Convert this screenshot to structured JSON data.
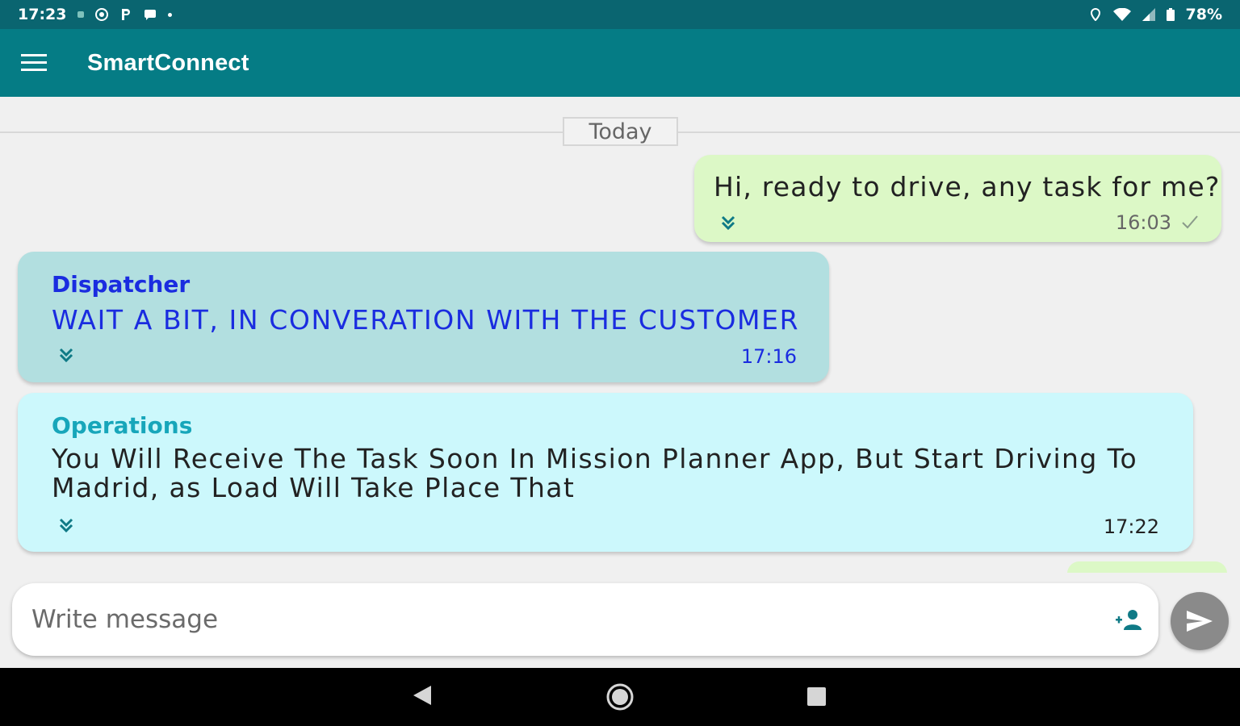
{
  "status_bar": {
    "time": "17:23",
    "battery": "78%",
    "icons": [
      "notification-dot-icon",
      "settings-circle-icon",
      "parking-icon",
      "message-icon",
      "more-dot-icon",
      "location-icon",
      "wifi-icon",
      "signal-icon",
      "battery-icon"
    ]
  },
  "app_bar": {
    "title": "SmartConnect",
    "menu_icon": "hamburger-menu-icon",
    "color": "#057c85"
  },
  "chat": {
    "date_separator": "Today",
    "messages": [
      {
        "direction": "outgoing",
        "text": "Hi, ready to drive, any task for me?",
        "time": "16:03",
        "status_icon": "check-icon",
        "bubble_color": "#dcf8c6"
      },
      {
        "direction": "incoming",
        "sender": "Dispatcher",
        "text": "WAIT A BIT, IN CONVERATION WITH THE CUSTOMER",
        "time": "17:16",
        "bubble_color": "#b2dfe0",
        "text_color": "#1a2ce0"
      },
      {
        "direction": "incoming",
        "sender": "Operations",
        "text": "You Will Receive The Task Soon In Mission Planner App, But Start Driving To Madrid, as Load Will Take Place That",
        "time": "17:22",
        "bubble_color": "#ccf8fc",
        "sender_color": "#17a6ba"
      }
    ]
  },
  "composer": {
    "placeholder": "Write message",
    "value": "",
    "contact_icon": "add-contact-icon",
    "send_icon": "send-icon"
  },
  "nav_bar": {
    "icons": [
      "back-icon",
      "home-icon",
      "recents-icon"
    ]
  }
}
